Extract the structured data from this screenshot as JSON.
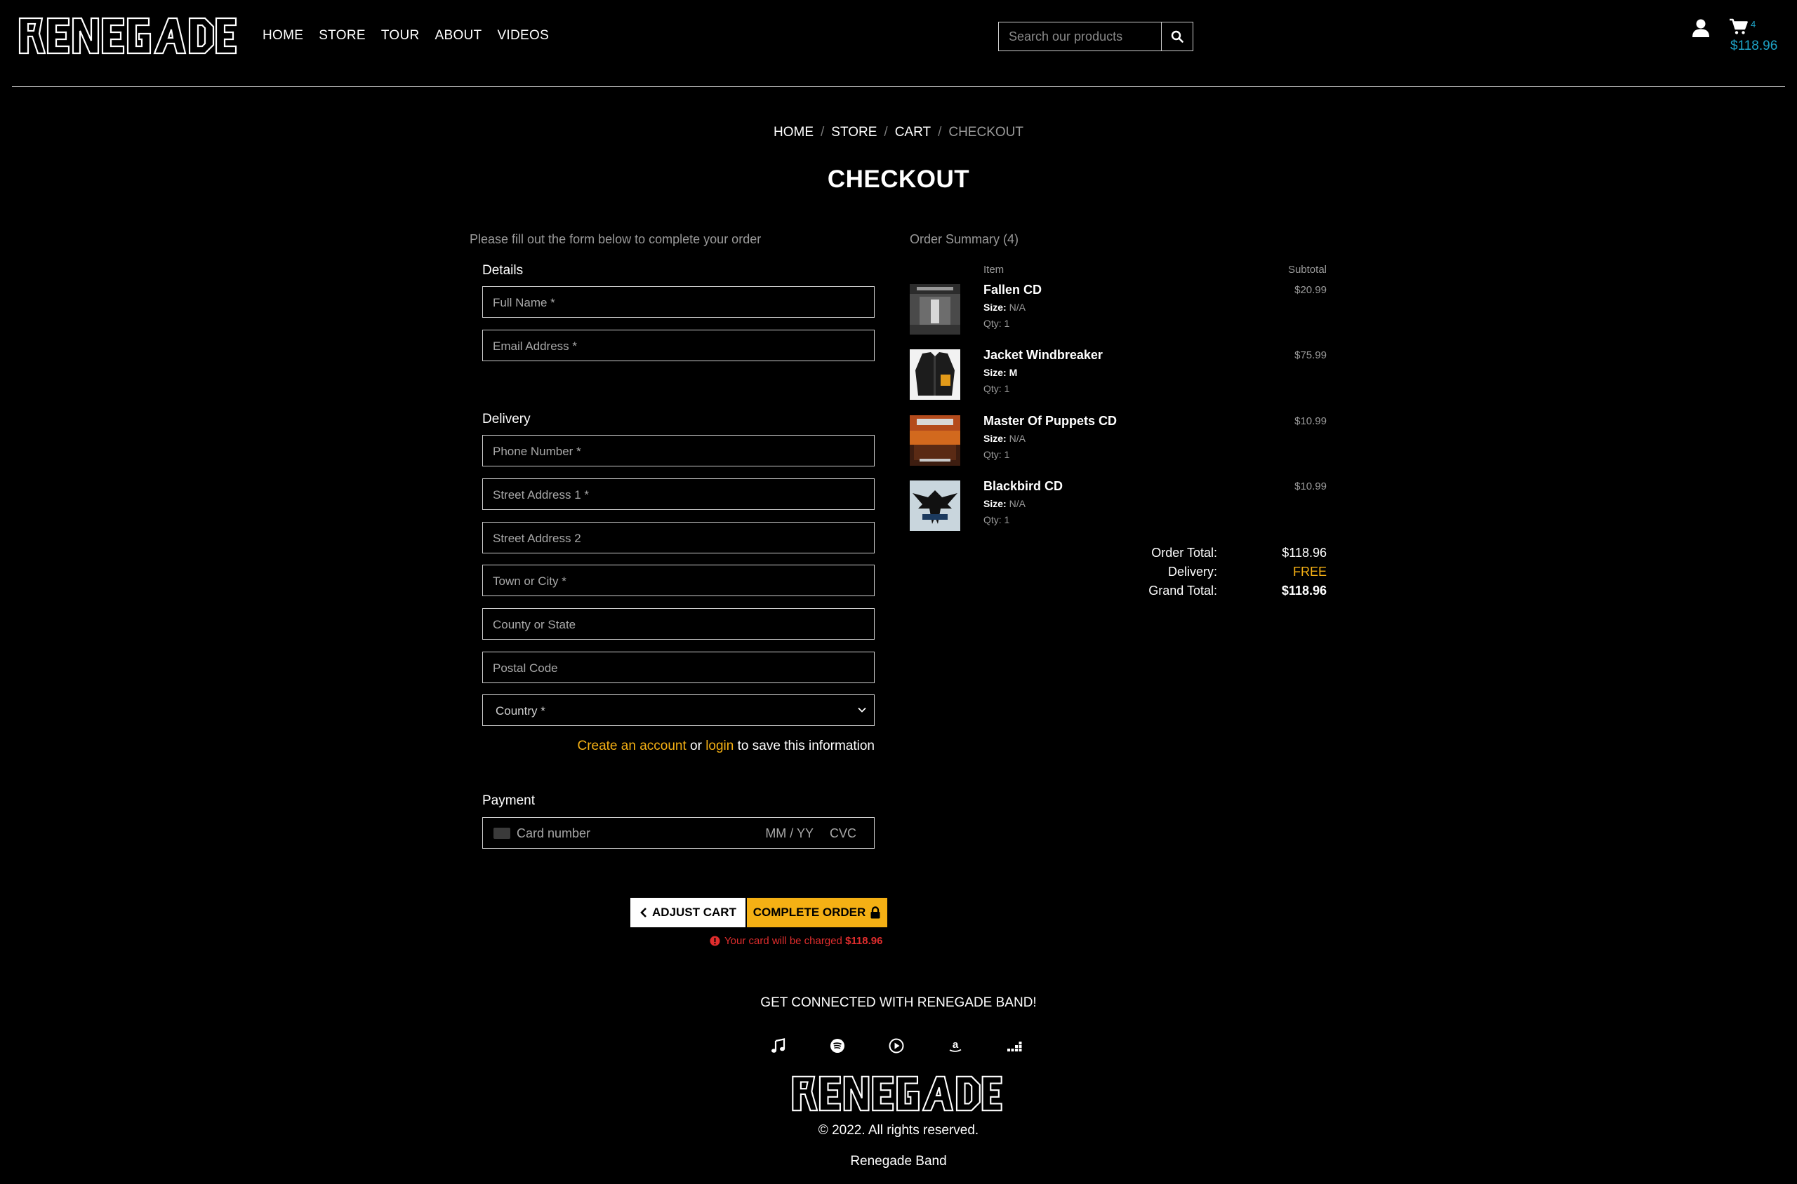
{
  "header": {
    "logo_text": "RENEGADE",
    "nav": [
      "HOME",
      "STORE",
      "TOUR",
      "ABOUT",
      "VIDEOS"
    ],
    "search_placeholder": "Search our products",
    "cart_count": "4",
    "cart_total": "$118.96"
  },
  "breadcrumb": {
    "home": "HOME",
    "store": "STORE",
    "cart": "CART",
    "current": "CHECKOUT"
  },
  "page_title": "CHECKOUT",
  "form": {
    "intro": "Please fill out the form below to complete your order",
    "details_label": "Details",
    "full_name": "Full Name *",
    "email": "Email Address *",
    "delivery_label": "Delivery",
    "phone": "Phone Number *",
    "street1": "Street Address 1 *",
    "street2": "Street Address 2",
    "town": "Town or City *",
    "county": "County or State",
    "postal": "Postal Code",
    "country": "Country *",
    "create_account": "Create an account",
    "or": " or ",
    "login": "login",
    "save_info": " to save this information",
    "payment_label": "Payment",
    "card_number": "Card number",
    "card_expiry": "MM / YY",
    "card_cvc": "CVC",
    "adjust_cart": "ADJUST CART",
    "complete_order": "COMPLETE ORDER",
    "charge_note": "Your card will be charged",
    "charge_amount": "$118.96"
  },
  "summary": {
    "title": "Order Summary (4)",
    "col_item": "Item",
    "col_subtotal": "Subtotal",
    "size_label": "Size:",
    "items": [
      {
        "name": "Fallen CD",
        "size": "N/A",
        "qty": "Qty: 1",
        "price": "$20.99"
      },
      {
        "name": "Jacket Windbreaker",
        "size": "M",
        "qty": "Qty: 1",
        "price": "$75.99"
      },
      {
        "name": "Master Of Puppets CD",
        "size": "N/A",
        "qty": "Qty: 1",
        "price": "$10.99"
      },
      {
        "name": "Blackbird CD",
        "size": "N/A",
        "qty": "Qty: 1",
        "price": "$10.99"
      }
    ],
    "order_total_label": "Order Total:",
    "order_total": "$118.96",
    "delivery_label": "Delivery:",
    "delivery": "FREE",
    "grand_total_label": "Grand Total:",
    "grand_total": "$118.96"
  },
  "footer": {
    "heading": "GET CONNECTED WITH RENEGADE BAND!",
    "social_icons": [
      "music-note-icon",
      "spotify-icon",
      "play-circle-icon",
      "amazon-icon",
      "deezer-icon"
    ],
    "copyright": "© 2022. All rights reserved.",
    "band": "Renegade Band"
  },
  "colors": {
    "accent": "#f5b014",
    "cart": "#1ea3c6",
    "error": "#e02d2d"
  }
}
